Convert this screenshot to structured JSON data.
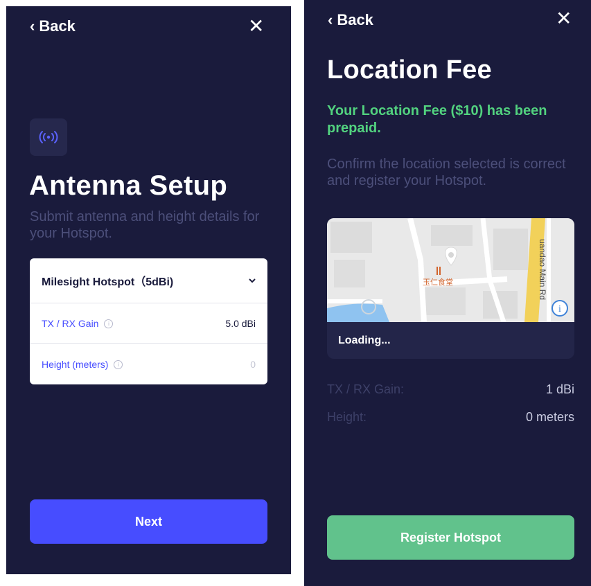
{
  "left_screen": {
    "back_label": "Back",
    "close_glyph": "✕",
    "title": "Antenna Setup",
    "subtitle": "Submit antenna and height details for your Hotspot.",
    "antenna_select": {
      "value": "Milesight Hotspot（5dBi)"
    },
    "gain_field": {
      "label": "TX / RX Gain",
      "value": "5.0 dBi"
    },
    "height_field": {
      "label": "Height (meters)",
      "value": "0"
    },
    "next_button": "Next"
  },
  "right_screen": {
    "back_label": "Back",
    "close_glyph": "✕",
    "title": "Location Fee",
    "fee_message": "Your Location Fee ($10) has been prepaid.",
    "confirm_message": "Confirm the location selected is correct and register your Hotspot.",
    "map": {
      "road_label": "uandao Main Rd",
      "poi_label": "玉仁食堂",
      "loading_text": "Loading..."
    },
    "details": [
      {
        "key": "TX / RX Gain:",
        "value": "1 dBi"
      },
      {
        "key": "Height:",
        "value": "0 meters"
      }
    ],
    "register_button": "Register Hotspot"
  },
  "colors": {
    "background": "#1a1b3c",
    "primary_blue": "#474dff",
    "success_green": "#52d27f",
    "register_green": "#61c28c"
  }
}
